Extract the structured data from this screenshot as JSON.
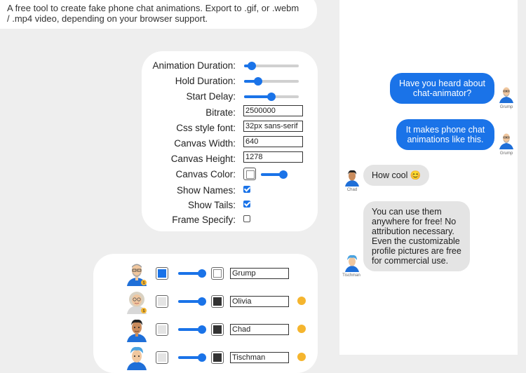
{
  "intro": {
    "text": "A free tool to create fake phone chat animations. Export to .gif, or .webm / .mp4 video, depending on your browser support."
  },
  "settings": {
    "animation_duration": {
      "label": "Animation Duration:",
      "value": 0.14
    },
    "hold_duration": {
      "label": "Hold Duration:",
      "value": 0.26
    },
    "start_delay": {
      "label": "Start Delay:",
      "value": 0.5
    },
    "bitrate": {
      "label": "Bitrate:",
      "value": "2500000"
    },
    "css_font": {
      "label": "Css style font:",
      "value": "32px sans-serif"
    },
    "canvas_width": {
      "label": "Canvas Width:",
      "value": "640"
    },
    "canvas_height": {
      "label": "Canvas Height:",
      "value": "1278"
    },
    "canvas_color": {
      "label": "Canvas Color:",
      "value": 0.9,
      "color": "#ffffff"
    },
    "show_names": {
      "label": "Show Names:",
      "checked": true
    },
    "show_tails": {
      "label": "Show Tails:",
      "checked": true
    },
    "frame_specify": {
      "label": "Frame Specify:",
      "checked": false
    }
  },
  "people": [
    {
      "name": "Grump",
      "bubble_color": "#1a73e8",
      "text_color": "#ffffff",
      "avatar": "grump-avatar"
    },
    {
      "name": "Olivia",
      "bubble_color": "#e4e4e4",
      "text_color": "#333333",
      "avatar": "olivia-avatar"
    },
    {
      "name": "Chad",
      "bubble_color": "#e4e4e4",
      "text_color": "#333333",
      "avatar": "chad-avatar"
    },
    {
      "name": "Tischman",
      "bubble_color": "#e4e4e4",
      "text_color": "#333333",
      "avatar": "tischman-avatar"
    }
  ],
  "chat": {
    "messages": [
      {
        "sender": "Grump",
        "text": "Have you heard about chat-animator?"
      },
      {
        "sender": "Grump",
        "text": "It makes phone chat animations like this."
      },
      {
        "sender": "Chad",
        "text": "How cool 😊"
      },
      {
        "sender": "Tischman",
        "text": "You can use them anywhere for free! No attribution necessary. Even the customizable profile pictures are free for commercial use."
      }
    ]
  },
  "colors": {
    "accent": "#1a73e8",
    "bubble_other": "#e4e4e4",
    "dot": "#f5b52e"
  }
}
